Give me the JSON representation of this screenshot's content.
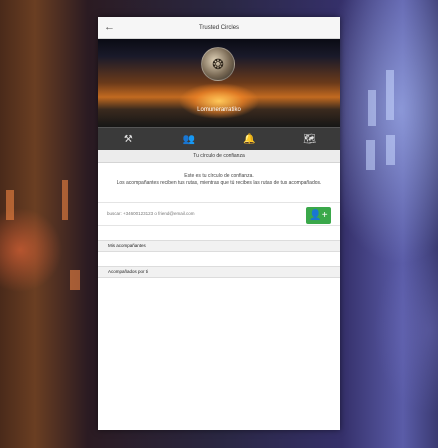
{
  "header": {
    "back_glyph": "←",
    "title": "Trusted Circles"
  },
  "profile": {
    "username": "Lomunerarratiko",
    "avatar_glyph": "❂"
  },
  "tabs": [
    {
      "icon": "tools-icon",
      "glyph": "⚒"
    },
    {
      "icon": "users-icon",
      "glyph": "👥"
    },
    {
      "icon": "bell-icon",
      "glyph": "🔔"
    },
    {
      "icon": "map-icon",
      "glyph": "🗺"
    }
  ],
  "circle": {
    "section_title": "Tu círculo de confianza",
    "description_line1": "Este es tu círculo de confianza.",
    "description_line2": "Los acompañantes reciben tus rutas, mientras que tú recibes las rutas de tus acompañados.",
    "search_placeholder": "buscar: +34600123123 o friend@email.com",
    "add_button_glyph": "👤+",
    "list_companions": "Mis acompañantes",
    "list_accompanied_by": "Acompañados por ti"
  },
  "colors": {
    "add_button": "#3aa84a",
    "tab_bar": "#3a3a3a"
  }
}
